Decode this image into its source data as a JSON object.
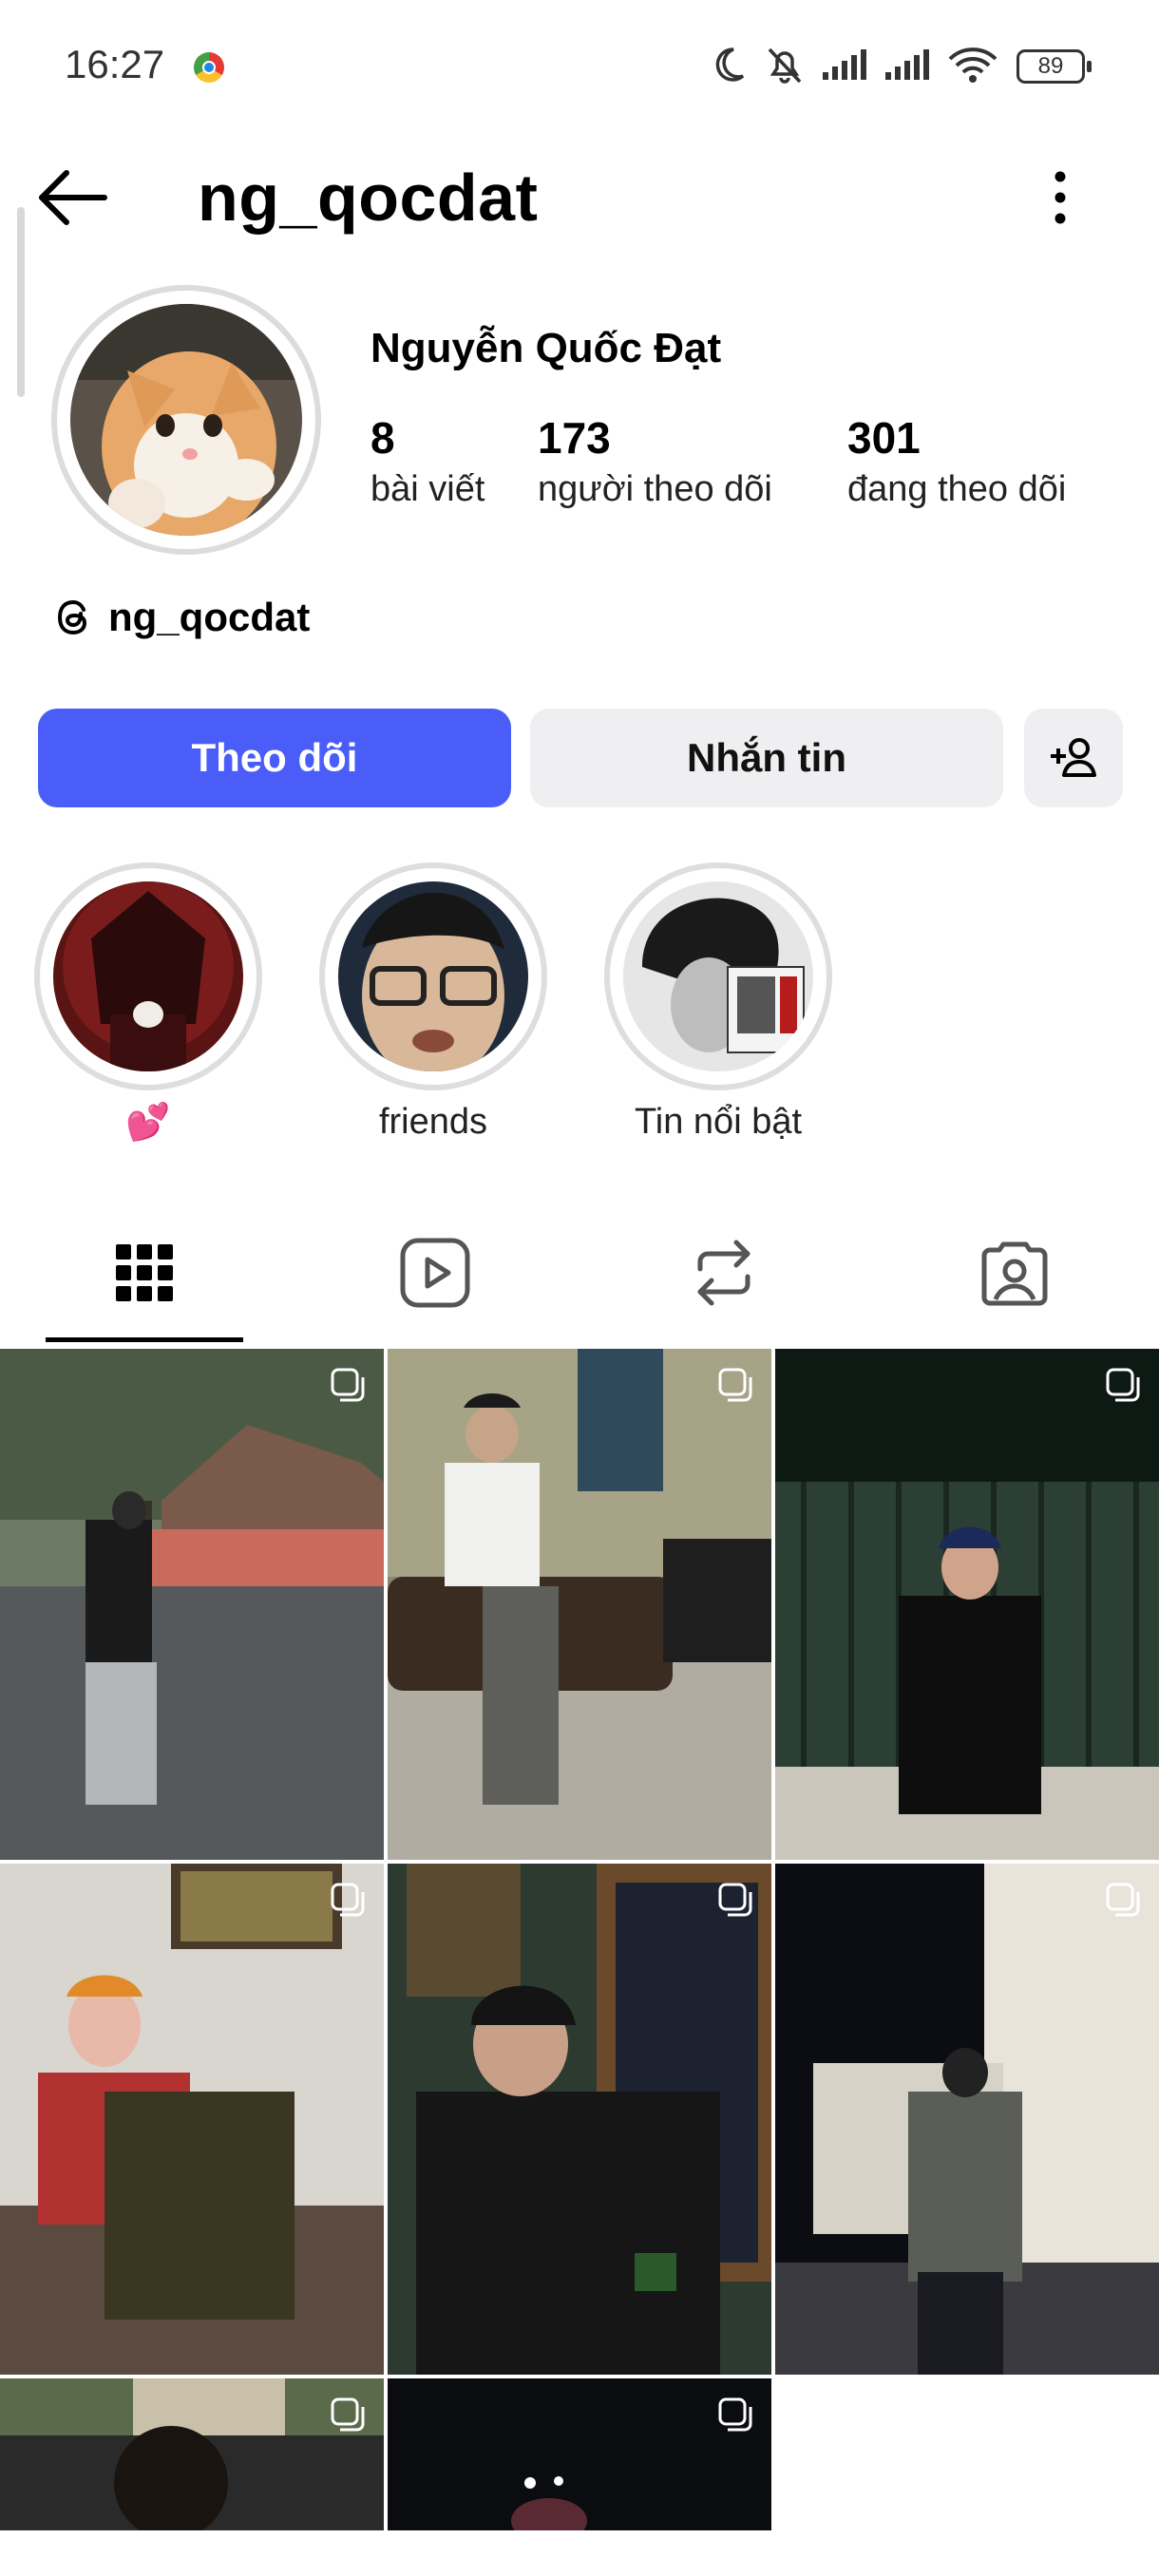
{
  "status_bar": {
    "time": "16:27",
    "battery": "89"
  },
  "header": {
    "username": "ng_qocdat"
  },
  "profile": {
    "display_name": "Nguyễn Quốc Đạt",
    "stats": [
      {
        "value": "8",
        "label": "bài viết"
      },
      {
        "value": "173",
        "label": "người theo dõi"
      },
      {
        "value": "301",
        "label": "đang theo dõi"
      }
    ],
    "threads_handle": "ng_qocdat"
  },
  "actions": {
    "follow_label": "Theo dõi",
    "message_label": "Nhắn tin"
  },
  "highlights": [
    {
      "label": "💕",
      "icon": "red-throne-cat"
    },
    {
      "label": "friends",
      "icon": "face-glasses"
    },
    {
      "label": "Tin nổi bật",
      "icon": "bw-portrait"
    }
  ],
  "tabs": [
    {
      "icon": "grid-icon",
      "active": true
    },
    {
      "icon": "reels-icon",
      "active": false
    },
    {
      "icon": "reposts-icon",
      "active": false
    },
    {
      "icon": "tagged-icon",
      "active": false
    }
  ],
  "posts": [
    {
      "type": "carousel"
    },
    {
      "type": "carousel"
    },
    {
      "type": "carousel"
    },
    {
      "type": "carousel"
    },
    {
      "type": "carousel"
    },
    {
      "type": "carousel"
    },
    {
      "type": "carousel"
    },
    {
      "type": "carousel"
    }
  ],
  "colors": {
    "accent": "#4a5df9",
    "secondary_button": "#efeff1"
  }
}
